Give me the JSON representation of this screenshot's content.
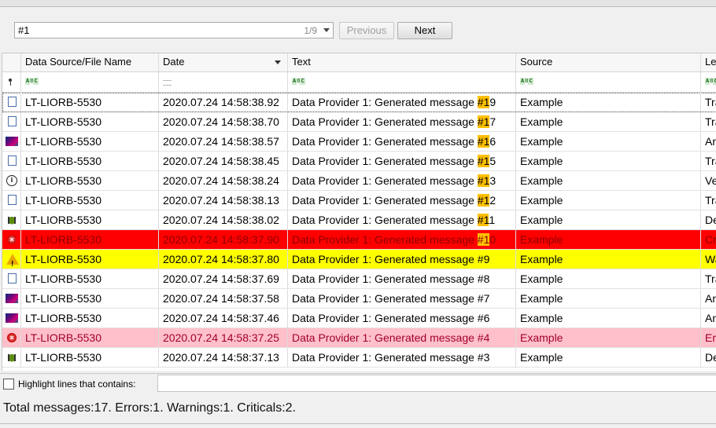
{
  "search": {
    "value": "#1",
    "match_count": "1/9",
    "previous_label": "Previous",
    "next_label": "Next"
  },
  "columns": [
    "Data Source/File Name",
    "Date",
    "Text",
    "Source",
    "Lev"
  ],
  "rows": [
    {
      "icon": "document-icon",
      "name": "LT-LIORB-5530",
      "date": "2020.07.24 14:58:38.92",
      "text_pre": "Data Provider 1: Generated message ",
      "text_hl": "#1",
      "text_post": "9",
      "source": "Example",
      "level": "Tra",
      "style": "normal"
    },
    {
      "icon": "document-icon",
      "name": "LT-LIORB-5530",
      "date": "2020.07.24 14:58:38.70",
      "text_pre": "Data Provider 1: Generated message ",
      "text_hl": "#1",
      "text_post": "7",
      "source": "Example",
      "level": "Tra",
      "style": "normal"
    },
    {
      "icon": "analytics-icon",
      "name": "LT-LIORB-5530",
      "date": "2020.07.24 14:58:38.57",
      "text_pre": "Data Provider 1: Generated message ",
      "text_hl": "#1",
      "text_post": "6",
      "source": "Example",
      "level": "An",
      "style": "normal"
    },
    {
      "icon": "document-icon",
      "name": "LT-LIORB-5530",
      "date": "2020.07.24 14:58:38.45",
      "text_pre": "Data Provider 1: Generated message ",
      "text_hl": "#1",
      "text_post": "5",
      "source": "Example",
      "level": "Tra",
      "style": "normal"
    },
    {
      "icon": "verbose-info-icon",
      "name": "LT-LIORB-5530",
      "date": "2020.07.24 14:58:38.24",
      "text_pre": "Data Provider 1: Generated message ",
      "text_hl": "#1",
      "text_post": "3",
      "source": "Example",
      "level": "Ve",
      "style": "normal"
    },
    {
      "icon": "document-icon",
      "name": "LT-LIORB-5530",
      "date": "2020.07.24 14:58:38.13",
      "text_pre": "Data Provider 1: Generated message ",
      "text_hl": "#1",
      "text_post": "2",
      "source": "Example",
      "level": "Tra",
      "style": "normal"
    },
    {
      "icon": "bug-icon",
      "name": "LT-LIORB-5530",
      "date": "2020.07.24 14:58:38.02",
      "text_pre": "Data Provider 1: Generated message ",
      "text_hl": "#1",
      "text_post": "1",
      "source": "Example",
      "level": "De",
      "style": "normal"
    },
    {
      "icon": "error-icon",
      "name": "LT-LIORB-5530",
      "date": "2020.07.24 14:58:37.90",
      "text_pre": "Data Provider 1: Generated message ",
      "text_hl": "#1",
      "text_post": "0",
      "source": "Example",
      "level": "Cri",
      "style": "red"
    },
    {
      "icon": "warning-icon",
      "name": "LT-LIORB-5530",
      "date": "2020.07.24 14:58:37.80",
      "text_pre": "Data Provider 1: Generated message #9",
      "text_hl": "",
      "text_post": "",
      "source": "Example",
      "level": "Wa",
      "style": "yellow"
    },
    {
      "icon": "document-icon",
      "name": "LT-LIORB-5530",
      "date": "2020.07.24 14:58:37.69",
      "text_pre": "Data Provider 1: Generated message #8",
      "text_hl": "",
      "text_post": "",
      "source": "Example",
      "level": "Tra",
      "style": "normal"
    },
    {
      "icon": "analytics-icon",
      "name": "LT-LIORB-5530",
      "date": "2020.07.24 14:58:37.58",
      "text_pre": "Data Provider 1: Generated message #7",
      "text_hl": "",
      "text_post": "",
      "source": "Example",
      "level": "An",
      "style": "normal"
    },
    {
      "icon": "analytics-icon",
      "name": "LT-LIORB-5530",
      "date": "2020.07.24 14:58:37.46",
      "text_pre": "Data Provider 1: Generated message #6",
      "text_hl": "",
      "text_post": "",
      "source": "Example",
      "level": "An",
      "style": "normal"
    },
    {
      "icon": "error-icon",
      "name": "LT-LIORB-5530",
      "date": "2020.07.24 14:58:37.25",
      "text_pre": "Data Provider 1: Generated message #4",
      "text_hl": "",
      "text_post": "",
      "source": "Example",
      "level": "Err",
      "style": "pink"
    },
    {
      "icon": "bug-icon",
      "name": "LT-LIORB-5530",
      "date": "2020.07.24 14:58:37.13",
      "text_pre": "Data Provider 1: Generated message #3",
      "text_hl": "",
      "text_post": "",
      "source": "Example",
      "level": "De",
      "style": "normal"
    }
  ],
  "highlight": {
    "label": "Highlight lines that contains:",
    "value": ""
  },
  "status": "Total messages:17. Errors:1. Warnings:1. Criticals:2.",
  "colors": {
    "critical_row": "#ff0000",
    "warning_row": "#ffff00",
    "error_row": "#ffc0cb",
    "search_highlight": "#ffc000"
  }
}
